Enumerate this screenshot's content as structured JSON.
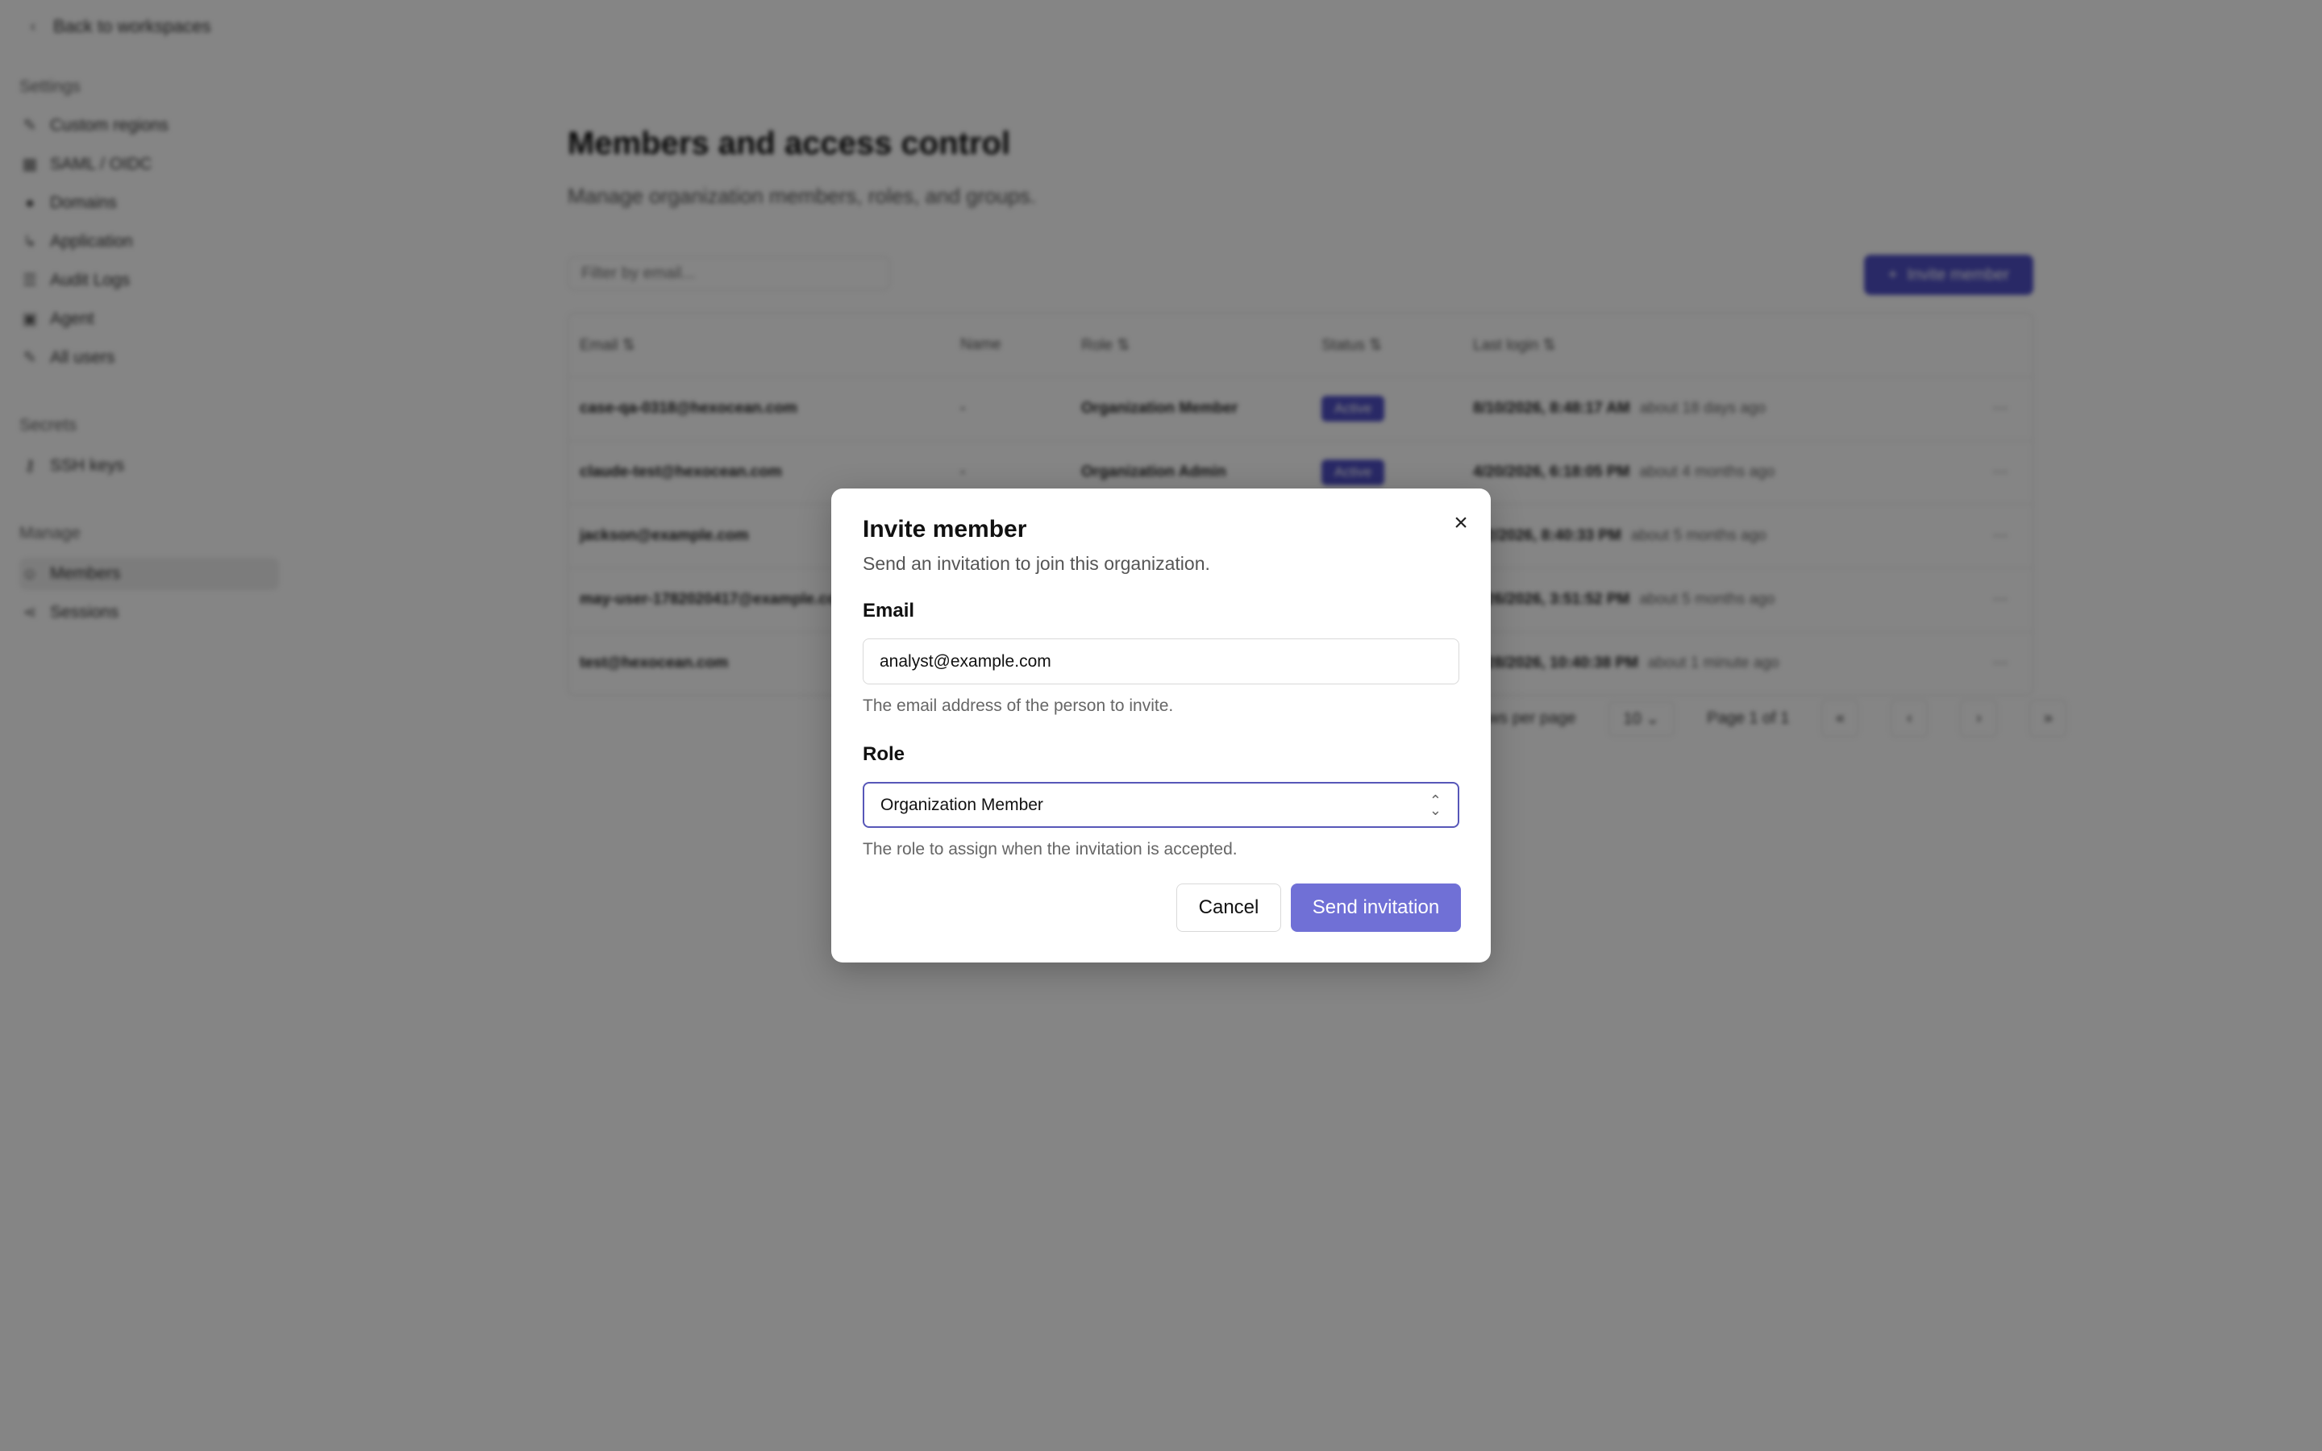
{
  "sidebar": {
    "back_label": "Back to workspaces",
    "sections": [
      {
        "title": "Settings",
        "items": [
          "Custom regions",
          "SAML / OIDC",
          "Domains",
          "Application",
          "Audit Logs",
          "Agent",
          "All users"
        ]
      },
      {
        "title": "Secrets",
        "items": [
          "SSH keys"
        ]
      },
      {
        "title": "Manage",
        "items": [
          "Members",
          "Sessions"
        ]
      }
    ]
  },
  "main": {
    "title": "Members and access control",
    "subtitle": "Manage organization members, roles, and groups.",
    "filter_placeholder": "Filter by email...",
    "invite_button": "Invite member",
    "table": {
      "headers": [
        "Email",
        "Name",
        "Role",
        "Status",
        "Last login"
      ],
      "rows": [
        {
          "email": "case-qa-0318@hexocean.com",
          "name": "-",
          "role": "Organization Member",
          "status": "Active",
          "last": "8/10/2026, 8:48:17 AM",
          "rel": "about 18 days ago"
        },
        {
          "email": "claude-test@hexocean.com",
          "name": "-",
          "role": "Organization Admin",
          "status": "Active",
          "last": "4/20/2026, 6:18:05 PM",
          "rel": "about 4 months ago"
        },
        {
          "email": "jackson@example.com",
          "name": "-",
          "role": "",
          "status": "",
          "last": "3/2/2026, 8:40:33 PM",
          "rel": "about 5 months ago"
        },
        {
          "email": "may-user-1782020417@example.com",
          "name": "",
          "role": "",
          "status": "",
          "last": "3/26/2026, 3:51:52 PM",
          "rel": "about 5 months ago"
        },
        {
          "email": "test@hexocean.com",
          "name": "",
          "role": "",
          "status": "",
          "last": "8/28/2026, 10:40:38 PM",
          "rel": "about 1 minute ago"
        }
      ]
    },
    "pagination": {
      "rows_label": "Rows per page",
      "rows_value": "10",
      "page_label": "Page 1 of 1"
    }
  },
  "dialog": {
    "title": "Invite member",
    "description": "Send an invitation to join this organization.",
    "email_label": "Email",
    "email_value": "analyst@example.com",
    "email_help": "The email address of the person to invite.",
    "role_label": "Role",
    "role_value": "Organization Member",
    "role_help": "The role to assign when the invitation is accepted.",
    "cancel_label": "Cancel",
    "send_label": "Send invitation"
  }
}
